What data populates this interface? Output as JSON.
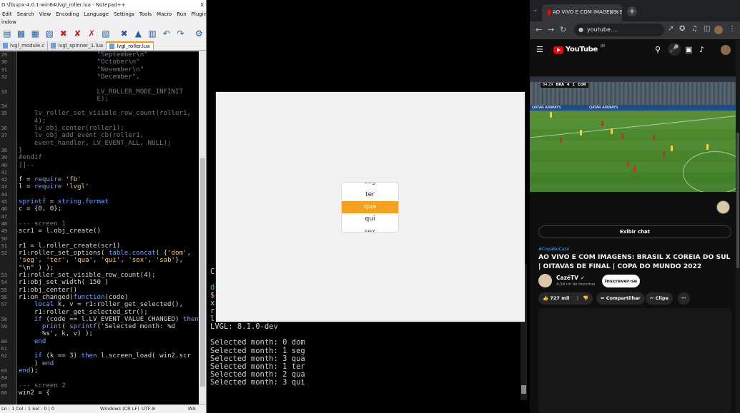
{
  "notepad": {
    "title": "D:\\fb\\upx-4.0.1-win64\\lvgl_roller.lua - Notepad++",
    "close": "X",
    "menu": [
      "Edit",
      "Search",
      "View",
      "Encoding",
      "Language",
      "Settings",
      "Tools",
      "Macro",
      "Run",
      "Plugins"
    ],
    "menu2": "indow",
    "tabs": [
      {
        "label": "lvgl_module.c",
        "active": false
      },
      {
        "label": "lvgl_spinner_1.lua",
        "active": false
      },
      {
        "label": "lvgl_roller.lua",
        "active": true
      }
    ],
    "lines": [
      {
        "n": "29",
        "t": "                    \"September\\n\"",
        "c": "cm"
      },
      {
        "n": "30",
        "t": "                    \"October\\n\"",
        "c": "cm"
      },
      {
        "n": "31",
        "t": "                    \"November\\n\"",
        "c": "cm"
      },
      {
        "n": "32",
        "t": "                    \"December\",",
        "c": "cm"
      },
      {
        "n": "",
        "t": "",
        "c": "cm"
      },
      {
        "n": "33",
        "t": "                    LV_ROLLER_MODE_INFINIT",
        "c": "cm"
      },
      {
        "n": "",
        "t": "                    E);",
        "c": "cm"
      },
      {
        "n": "34",
        "t": "",
        "c": "cm"
      },
      {
        "n": "35",
        "t": "    lv_roller_set_visible_row_count(roller1,",
        "c": "cm"
      },
      {
        "n": "",
        "t": "    4);",
        "c": "cm"
      },
      {
        "n": "36",
        "t": "    lv_obj_center(roller1);",
        "c": "cm"
      },
      {
        "n": "37",
        "t": "    lv_obj_add_event_cb(roller1,",
        "c": "cm"
      },
      {
        "n": "",
        "t": "    event_handler, LV_EVENT_ALL, NULL);",
        "c": "cm"
      },
      {
        "n": "38",
        "t": "}",
        "c": "cm"
      },
      {
        "n": "39",
        "t": "#endif",
        "c": "cm"
      },
      {
        "n": "40",
        "t": "]]--",
        "c": "cm"
      },
      {
        "n": "41",
        "t": "",
        "c": ""
      },
      {
        "n": "42",
        "t": "f = require 'fb'",
        "c": ""
      },
      {
        "n": "43",
        "t": "l = require 'lvgl'",
        "c": ""
      },
      {
        "n": "44",
        "t": "",
        "c": ""
      },
      {
        "n": "45",
        "t": "sprintf = string.format",
        "c": ""
      },
      {
        "n": "46",
        "t": "c = {0, 0};",
        "c": ""
      },
      {
        "n": "47",
        "t": "",
        "c": ""
      },
      {
        "n": "48",
        "t": "--- screen 1",
        "c": "cm"
      },
      {
        "n": "49",
        "t": "scr1 = l.obj_create()",
        "c": ""
      },
      {
        "n": "50",
        "t": "",
        "c": ""
      },
      {
        "n": "51",
        "t": "r1 = l.roller_create(scr1)",
        "c": ""
      },
      {
        "n": "52",
        "t": "r1:roller_set_options( table.concat( {'dom',",
        "c": ""
      },
      {
        "n": "",
        "t": "'seg', 'ter', 'qua', 'qui', 'sex', 'sab'},",
        "c": ""
      },
      {
        "n": "",
        "t": "\"\\n\" ) );",
        "c": ""
      },
      {
        "n": "53",
        "t": "r1:roller_set_visible_row_count(4);",
        "c": ""
      },
      {
        "n": "54",
        "t": "r1:obj_set_width( 150 )",
        "c": ""
      },
      {
        "n": "55",
        "t": "r1:obj_center()",
        "c": ""
      },
      {
        "n": "56",
        "t": "r1:on_changed(function(code)",
        "c": ""
      },
      {
        "n": "57",
        "t": "    local k, v = r1:roller_get_selected(),",
        "c": ""
      },
      {
        "n": "",
        "t": "    r1:roller_get_selected_str();",
        "c": ""
      },
      {
        "n": "58",
        "t": "    if (code == l.LV_EVENT_VALUE_CHANGED) then",
        "c": ""
      },
      {
        "n": "59",
        "t": "      print( sprintf('Selected month: %d",
        "c": ""
      },
      {
        "n": "",
        "t": "      %s', k, v) );",
        "c": ""
      },
      {
        "n": "60",
        "t": "    end",
        "c": ""
      },
      {
        "n": "61",
        "t": "",
        "c": ""
      },
      {
        "n": "62",
        "t": "    if (k == 3) then l.screen_load( win2.scr",
        "c": ""
      },
      {
        "n": "",
        "t": "    ) end",
        "c": ""
      },
      {
        "n": "63",
        "t": "end);",
        "c": ""
      },
      {
        "n": "64",
        "t": "",
        "c": ""
      },
      {
        "n": "65",
        "t": "--- screen 2",
        "c": "cm"
      },
      {
        "n": "66",
        "t": "win2 = {",
        "c": ""
      }
    ],
    "status": {
      "pos": "Ln : 1    Col : 1    Sel : 0 | 0",
      "eol": "Windows (CR LF)",
      "enc": "UTF-8",
      "mode": "INS"
    }
  },
  "console": {
    "lines": [
      {
        "t": "C",
        "g": false
      },
      {
        "t": "",
        "g": false
      },
      {
        "t": "d",
        "g": true
      },
      {
        "t": "$",
        "g": false
      },
      {
        "t": "x",
        "g": false
      },
      {
        "t": "r",
        "g": false
      },
      {
        "t": "l",
        "g": false
      },
      {
        "t": "LVGL: 8.1.0-dev",
        "g": false
      },
      {
        "t": "",
        "g": false
      },
      {
        "t": "Selected month: 0 dom",
        "g": false
      },
      {
        "t": "Selected month: 1 seg",
        "g": false
      },
      {
        "t": "Selected month: 3 qua",
        "g": false
      },
      {
        "t": "Selected month: 1 ter",
        "g": false
      },
      {
        "t": "Selected month: 2 qua",
        "g": false
      },
      {
        "t": "Selected month: 3 qui",
        "g": false
      }
    ]
  },
  "lvgl": {
    "roller_options": [
      "seg",
      "ter",
      "qua",
      "qui",
      "sex"
    ],
    "selected": "qua",
    "accent": "#f4a11e"
  },
  "chrome": {
    "tab_title": "AO VIVO E COM IMAGENS: B",
    "address": "youtube....",
    "yt_logo": "YouTube",
    "yt_region": "BR",
    "score": {
      "home": "BRA",
      "away": "COR",
      "home_score": "4",
      "away_score": "1",
      "clock": "84:29"
    },
    "chat_button": "Exibir chat",
    "hashtag": "#CopaNoCazé",
    "video_title": "AO VIVO E COM IMAGENS: BRASIL X COREIA DO SUL | OITAVAS DE FINAL | COPA DO MUNDO 2022",
    "channel": "CazéTV",
    "subscribers": "4,34 mi de inscritos",
    "subscribe": "Inscrever-se",
    "likes": "727 mil",
    "share": "Compartilhar",
    "clip": "Clipe"
  }
}
